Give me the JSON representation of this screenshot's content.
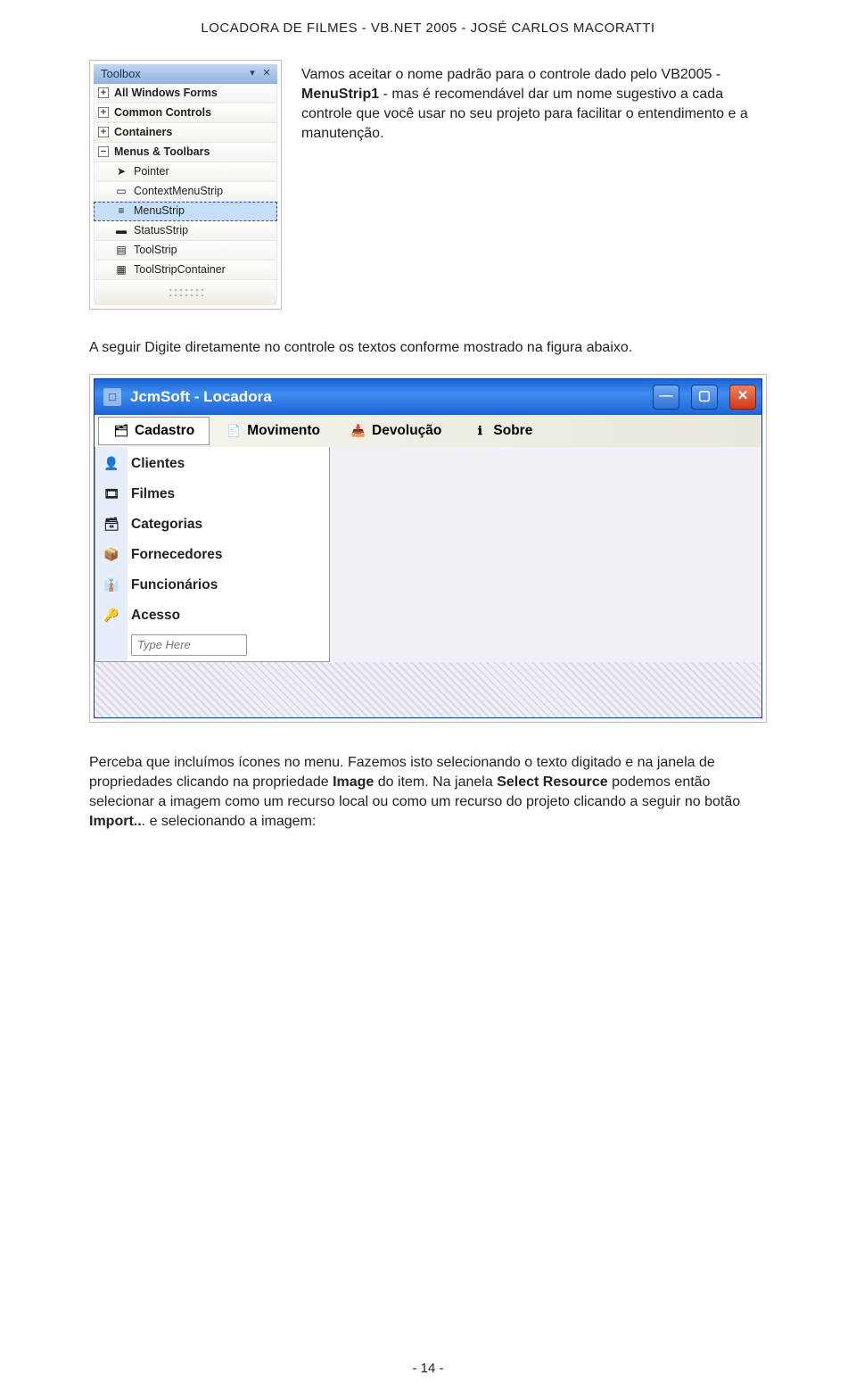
{
  "header": "LOCADORA DE FILMES  -  VB.NET 2005 - JOSÉ CARLOS MACORATTI",
  "page_number": "- 14 -",
  "toolbox": {
    "title": "Toolbox",
    "groups": [
      {
        "label": "All Windows Forms",
        "expanded": false
      },
      {
        "label": "Common Controls",
        "expanded": false
      },
      {
        "label": "Containers",
        "expanded": false
      },
      {
        "label": "Menus & Toolbars",
        "expanded": true,
        "items": [
          {
            "label": "Pointer",
            "icon": "pointer-icon"
          },
          {
            "label": "ContextMenuStrip",
            "icon": "context-menu-icon"
          },
          {
            "label": "MenuStrip",
            "icon": "menu-strip-icon",
            "selected": true
          },
          {
            "label": "StatusStrip",
            "icon": "status-strip-icon"
          },
          {
            "label": "ToolStrip",
            "icon": "tool-strip-icon"
          },
          {
            "label": "ToolStripContainer",
            "icon": "tool-strip-container-icon"
          }
        ]
      }
    ]
  },
  "para1_parts": {
    "t1": "Vamos aceitar o nome padrão para o controle dado pelo VB2005 - ",
    "b1": "MenuStrip1",
    "t2": " - mas é recomendável dar um nome sugestivo a cada controle que você usar no seu projeto para facilitar o entendimento e a manutenção."
  },
  "mid_para": "A seguir Digite diretamente no controle os textos conforme mostrado na figura abaixo.",
  "locadora_window": {
    "title": "JcmSoft - Locadora",
    "menubar": [
      {
        "label": "Cadastro",
        "icon": "folder-icon",
        "active": true
      },
      {
        "label": "Movimento",
        "icon": "movimento-icon"
      },
      {
        "label": "Devolução",
        "icon": "devolucao-icon"
      },
      {
        "label": "Sobre",
        "icon": "sobre-icon"
      }
    ],
    "cadastro_items": [
      {
        "label": "Clientes",
        "icon": "clientes-icon"
      },
      {
        "label": "Filmes",
        "icon": "filmes-icon"
      },
      {
        "label": "Categorias",
        "icon": "categorias-icon"
      },
      {
        "label": "Fornecedores",
        "icon": "fornecedores-icon"
      },
      {
        "label": "Funcionários",
        "icon": "funcionarios-icon"
      },
      {
        "label": "Acesso",
        "icon": "acesso-icon"
      }
    ],
    "type_here_placeholder": "Type Here"
  },
  "para2_parts": {
    "t1": "Perceba que incluímos ícones no menu. Fazemos isto selecionando o texto digitado e na janela de propriedades clicando na propriedade ",
    "b1": "Image",
    "t2": " do item. Na janela ",
    "b2": "Select Resource",
    "t3": " podemos então selecionar a imagem como um recurso local ou como um recurso do projeto clicando a seguir no botão ",
    "b3": "Import..",
    "t4": ". e selecionando a imagem:"
  }
}
